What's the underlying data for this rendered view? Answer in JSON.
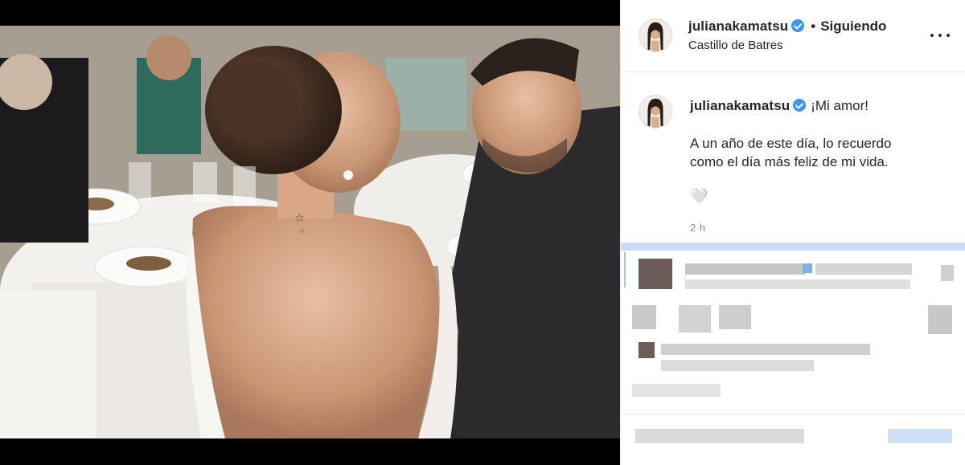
{
  "post": {
    "username": "julianakamatsu",
    "separator": "•",
    "follow_status": "Siguiendo",
    "location": "Castillo de Batres"
  },
  "caption": {
    "username": "julianakamatsu",
    "title": "¡Mi amor!",
    "body_line1": "A un año de este día, lo recuerdo",
    "body_line2": "como el día más feliz de mi vida.",
    "emoji": "🤍",
    "time": "2 h"
  },
  "icons": {
    "verified": "verified-badge-icon",
    "more": "more-options-icon",
    "heart": "white-heart-icon"
  },
  "colors": {
    "verified_blue": "#3897f0",
    "text": "#262626",
    "muted": "#8e8e8e",
    "photo_frame": "#000000"
  }
}
